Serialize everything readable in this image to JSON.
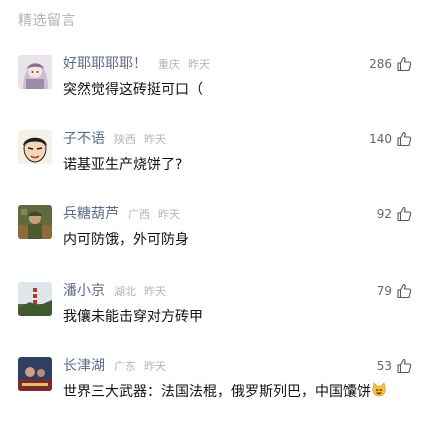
{
  "section": {
    "title": "精选留言"
  },
  "comments": [
    {
      "name": "好耶耶耶耶！",
      "location": "重庆",
      "time": "昨天",
      "likes": "286",
      "content": "突然觉得这砖挺可口（",
      "avatar_icon": "anime-girl-avatar"
    },
    {
      "name": "子不语",
      "location": "陕西",
      "time": "昨天",
      "likes": "140",
      "content": "诺基亚生产烧饼了?",
      "avatar_icon": "cartoon-face-avatar"
    },
    {
      "name": "兵糖葫芦",
      "location": "广西",
      "time": "昨天",
      "likes": "92",
      "content": "内可防饿，外可防身",
      "avatar_icon": "soldier-photo-avatar"
    },
    {
      "name": "潘小京",
      "location": "湖北",
      "time": "昨天",
      "likes": "79",
      "content": "我儴未能击穿对方砖甲",
      "avatar_icon": "tower-photo-avatar"
    },
    {
      "name": "长津湖",
      "location": "广东",
      "time": "昨天",
      "likes": "53",
      "content": "世界三大武器：法国法棍，俄罗斯列巴，中国馕饼",
      "avatar_icon": "movie-poster-avatar",
      "trailing_emoji": "grinning-cat-emoji"
    }
  ],
  "colors": {
    "name": "#5c6b8a",
    "meta": "#b4b4b4",
    "section_title": "#b2b2b2",
    "text": "#111111"
  },
  "icons": {
    "like": "thumbs-up-icon"
  }
}
